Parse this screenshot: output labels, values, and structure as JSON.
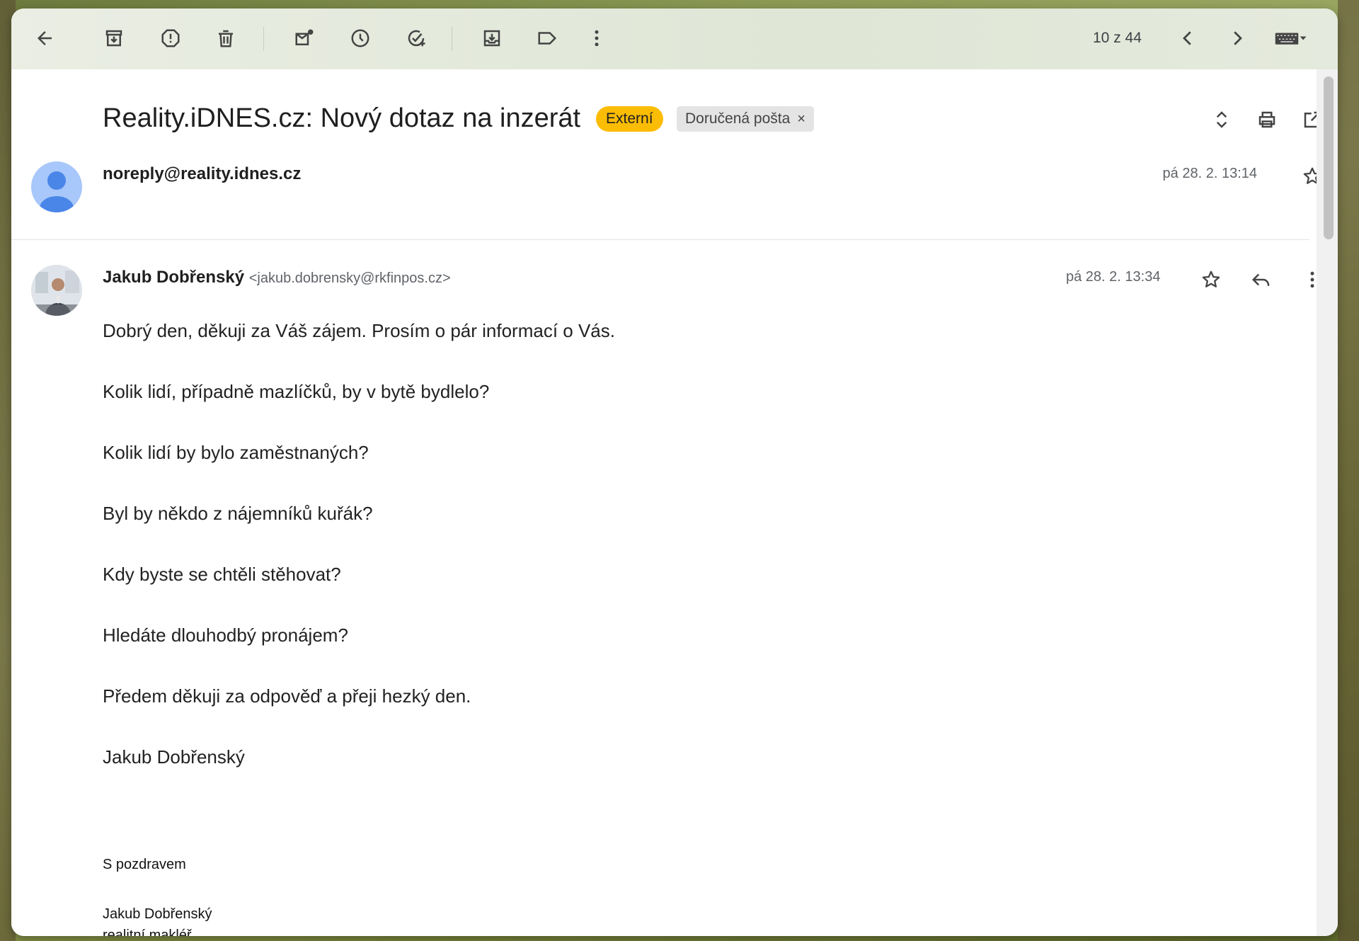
{
  "toolbar": {
    "pager": "10 z 44",
    "icons": [
      "back-arrow-icon",
      "archive-icon",
      "report-spam-icon",
      "delete-icon",
      "mark-unread-icon",
      "snooze-icon",
      "add-task-icon",
      "move-to-icon",
      "label-icon",
      "more-vert-icon",
      "chevron-left-icon",
      "chevron-right-icon",
      "keyboard-icon"
    ]
  },
  "email": {
    "subject": "Reality.iDNES.cz: Nový dotaz na inzerát",
    "badge_external": "Externí",
    "badge_inbox": "Doručená pošta",
    "badge_inbox_close": "×"
  },
  "message1": {
    "sender": "noreply@reality.idnes.cz",
    "date": "pá 28. 2. 13:14"
  },
  "message2": {
    "sender_name": "Jakub Dobřenský",
    "sender_address": "<jakub.dobrensky@rkfinpos.cz>",
    "date": "pá 28. 2. 13:34",
    "body": [
      "Dobrý den, děkuji za Váš zájem. Prosím o pár informací o Vás.",
      "Kolik lidí, případně mazlíčků, by v bytě bydlelo?",
      "Kolik lidí by bylo zaměstnaných?",
      "Byl by někdo z nájemníků kuřák?",
      "Kdy byste se chtěli stěhovat?",
      "Hledáte dlouhodbý pronájem?",
      "Předem děkuji za odpověď a přeji hezký den.",
      "Jakub Dobřenský"
    ],
    "signature": {
      "greeting": "S pozdravem",
      "name": "Jakub Dobřenský",
      "role": "realitní makléř"
    }
  },
  "colors": {
    "external_badge": "#fbbc04",
    "inbox_badge": "#e4e4e4",
    "avatar_default": "#a8c7fa",
    "avatar_figure": "#4a86e8"
  }
}
